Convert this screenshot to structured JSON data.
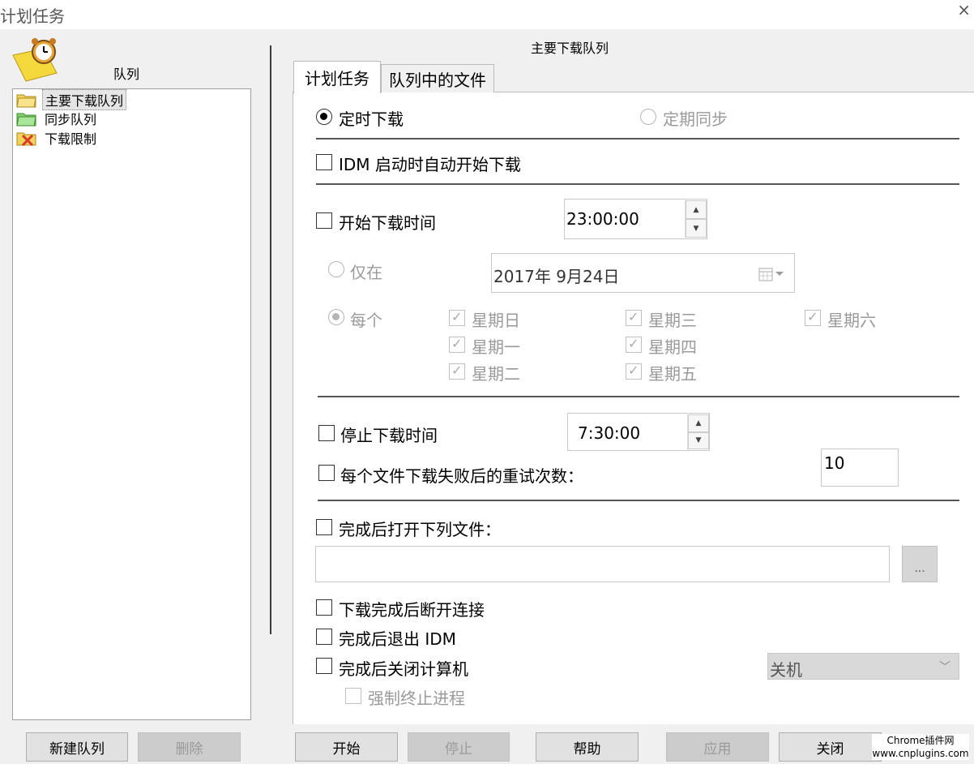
{
  "window": {
    "title": "计划任务",
    "close_glyph": "×"
  },
  "left_pane": {
    "header_label": "队列",
    "queues": [
      {
        "label": "主要下载队列",
        "icon": "yellow-folder-icon",
        "selected": true
      },
      {
        "label": "同步队列",
        "icon": "green-folder-icon",
        "selected": false
      },
      {
        "label": "下载限制",
        "icon": "limit-folder-icon",
        "selected": false
      }
    ],
    "buttons": {
      "new_queue": "新建队列",
      "delete": "删除"
    }
  },
  "main": {
    "queue_title": "主要下载队列",
    "tabs": [
      {
        "label": "计划任务",
        "active": true
      },
      {
        "label": "队列中的文件",
        "active": false
      }
    ],
    "mode": {
      "timed_label": "定时下载",
      "periodic_label": "定期同步",
      "selected": "timed"
    },
    "auto_start_idm_label": "IDM 启动时自动开始下载",
    "start_time": {
      "label": "开始下载时间",
      "value": "23:00:00"
    },
    "only_on": {
      "label": "仅在",
      "date": "2017年  9月24日"
    },
    "every": {
      "label": "每个",
      "days": [
        {
          "label": "星期日",
          "checked": true
        },
        {
          "label": "星期一",
          "checked": true
        },
        {
          "label": "星期二",
          "checked": true
        },
        {
          "label": "星期三",
          "checked": true
        },
        {
          "label": "星期四",
          "checked": true
        },
        {
          "label": "星期五",
          "checked": true
        },
        {
          "label": "星期六",
          "checked": true
        }
      ]
    },
    "stop_time": {
      "label": "停止下载时间",
      "value": "7:30:00"
    },
    "retry": {
      "label": "每个文件下载失败后的重试次数：",
      "value": "10"
    },
    "open_file": {
      "label": "完成后打开下列文件：",
      "value": "",
      "browse_label": "..."
    },
    "disconnect_label": "下载完成后断开连接",
    "exit_idm_label": "完成后退出 IDM",
    "shutdown": {
      "label": "完成后关闭计算机",
      "option": "关机"
    },
    "force_kill_label": "强制终止进程"
  },
  "footer_buttons": {
    "start": "开始",
    "stop": "停止",
    "help": "帮助",
    "apply": "应用",
    "close": "关闭"
  },
  "watermark": {
    "line1": "Chrome插件网",
    "line2": "www.cnplugins.com"
  },
  "colors": {
    "tree_folder_yellow": "#f2d35a",
    "tree_folder_green": "#7fd36b",
    "limit_x_red": "#d83a2a"
  }
}
